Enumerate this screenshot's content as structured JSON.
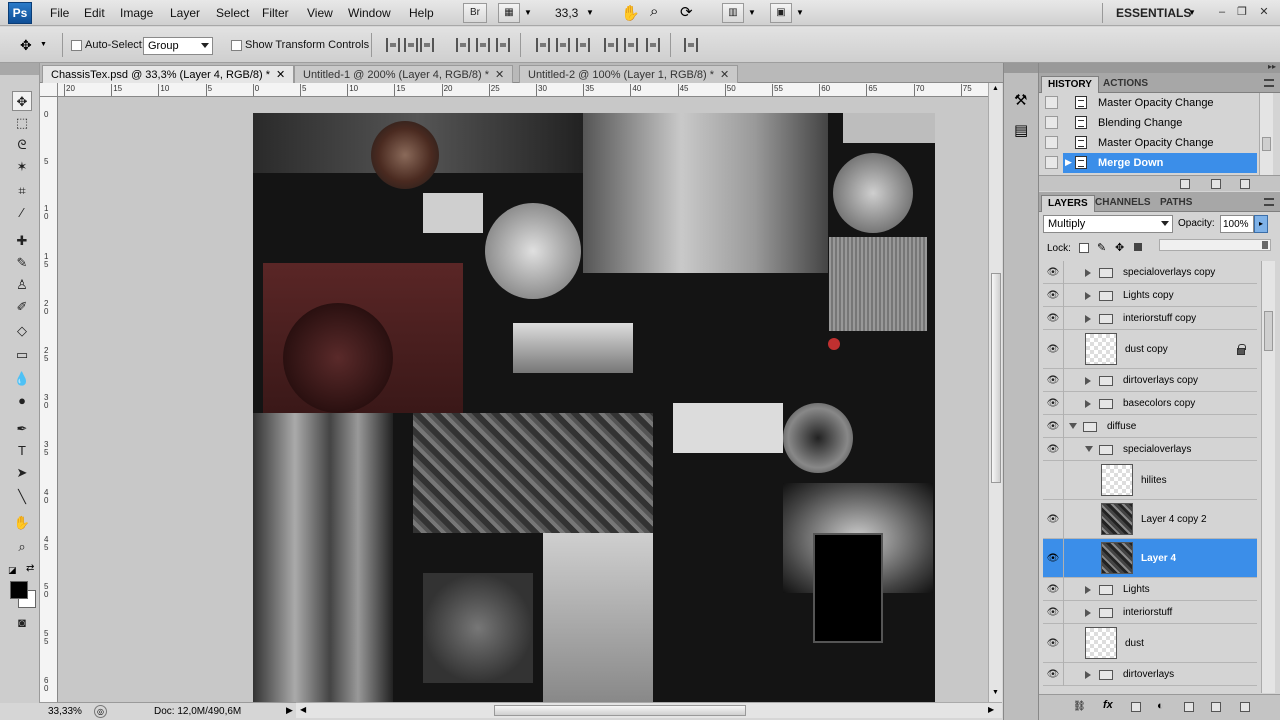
{
  "app": {
    "logo": "Ps",
    "workspace": "ESSENTIALS"
  },
  "menu": [
    "File",
    "Edit",
    "Image",
    "Layer",
    "Select",
    "Filter",
    "View",
    "Window",
    "Help"
  ],
  "menubar": {
    "bridge_btn": "Br",
    "zoom": "33,3"
  },
  "options": {
    "auto_select_label": "Auto-Select:",
    "auto_select_value": "Group",
    "show_transform_label": "Show Transform Controls"
  },
  "tabs": [
    {
      "label": "ChassisTex.psd @ 33,3% (Layer 4, RGB/8) *",
      "active": true
    },
    {
      "label": "Untitled-1 @ 200% (Layer 4, RGB/8) *",
      "active": false
    },
    {
      "label": "Untitled-2 @ 100% (Layer 1, RGB/8) *",
      "active": false
    }
  ],
  "ruler_top": [
    "20",
    "15",
    "10",
    "5",
    "0",
    "5",
    "10",
    "15",
    "20",
    "25",
    "30",
    "35",
    "40",
    "45",
    "50",
    "55",
    "60",
    "65",
    "70",
    "75"
  ],
  "ruler_left": [
    "0",
    "5",
    "1\n0",
    "1\n5",
    "2\n0",
    "2\n5",
    "3\n0",
    "3\n5",
    "4\n0",
    "4\n5",
    "5\n0",
    "5\n5",
    "6\n0"
  ],
  "status": {
    "zoom": "33,33%",
    "doc": "Doc: 12,0M/490,6M"
  },
  "history": {
    "tabs": [
      "HISTORY",
      "ACTIONS"
    ],
    "items": [
      {
        "label": "Master Opacity Change",
        "active": false
      },
      {
        "label": "Blending Change",
        "active": false
      },
      {
        "label": "Master Opacity Change",
        "active": false
      },
      {
        "label": "Merge Down",
        "active": true
      }
    ]
  },
  "layers": {
    "tabs": [
      "LAYERS",
      "CHANNELS",
      "PATHS"
    ],
    "blend_mode": "Multiply",
    "opacity_label": "Opacity:",
    "opacity_value": "100%",
    "lock_label": "Lock:",
    "items": [
      {
        "name": "specialoverlays copy",
        "type": "group",
        "level": 1,
        "expanded": false,
        "visible": true,
        "active": false
      },
      {
        "name": "Lights copy",
        "type": "group",
        "level": 1,
        "expanded": false,
        "visible": true,
        "active": false
      },
      {
        "name": "interiorstuff copy",
        "type": "group",
        "level": 1,
        "expanded": false,
        "visible": true,
        "active": false
      },
      {
        "name": "dust copy",
        "type": "layer-trans",
        "level": 1,
        "visible": true,
        "active": false,
        "locked": true
      },
      {
        "name": "dirtoverlays copy",
        "type": "group",
        "level": 1,
        "expanded": false,
        "visible": true,
        "active": false
      },
      {
        "name": "basecolors copy",
        "type": "group",
        "level": 1,
        "expanded": false,
        "visible": true,
        "active": false
      },
      {
        "name": "diffuse",
        "type": "group",
        "level": 0,
        "expanded": true,
        "visible": true,
        "active": false
      },
      {
        "name": "specialoverlays",
        "type": "group",
        "level": 1,
        "expanded": true,
        "visible": true,
        "active": false
      },
      {
        "name": "hilites",
        "type": "layer-trans",
        "level": 2,
        "visible": false,
        "active": false
      },
      {
        "name": "Layer 4 copy 2",
        "type": "layer-img",
        "level": 2,
        "visible": true,
        "active": false
      },
      {
        "name": "Layer 4",
        "type": "layer-img",
        "level": 2,
        "visible": true,
        "active": true
      },
      {
        "name": "Lights",
        "type": "group",
        "level": 1,
        "expanded": false,
        "visible": true,
        "active": false
      },
      {
        "name": "interiorstuff",
        "type": "group",
        "level": 1,
        "expanded": false,
        "visible": true,
        "active": false
      },
      {
        "name": "dust",
        "type": "layer-trans",
        "level": 1,
        "visible": true,
        "active": false
      },
      {
        "name": "dirtoverlays",
        "type": "group",
        "level": 1,
        "expanded": false,
        "visible": true,
        "active": false
      }
    ]
  }
}
